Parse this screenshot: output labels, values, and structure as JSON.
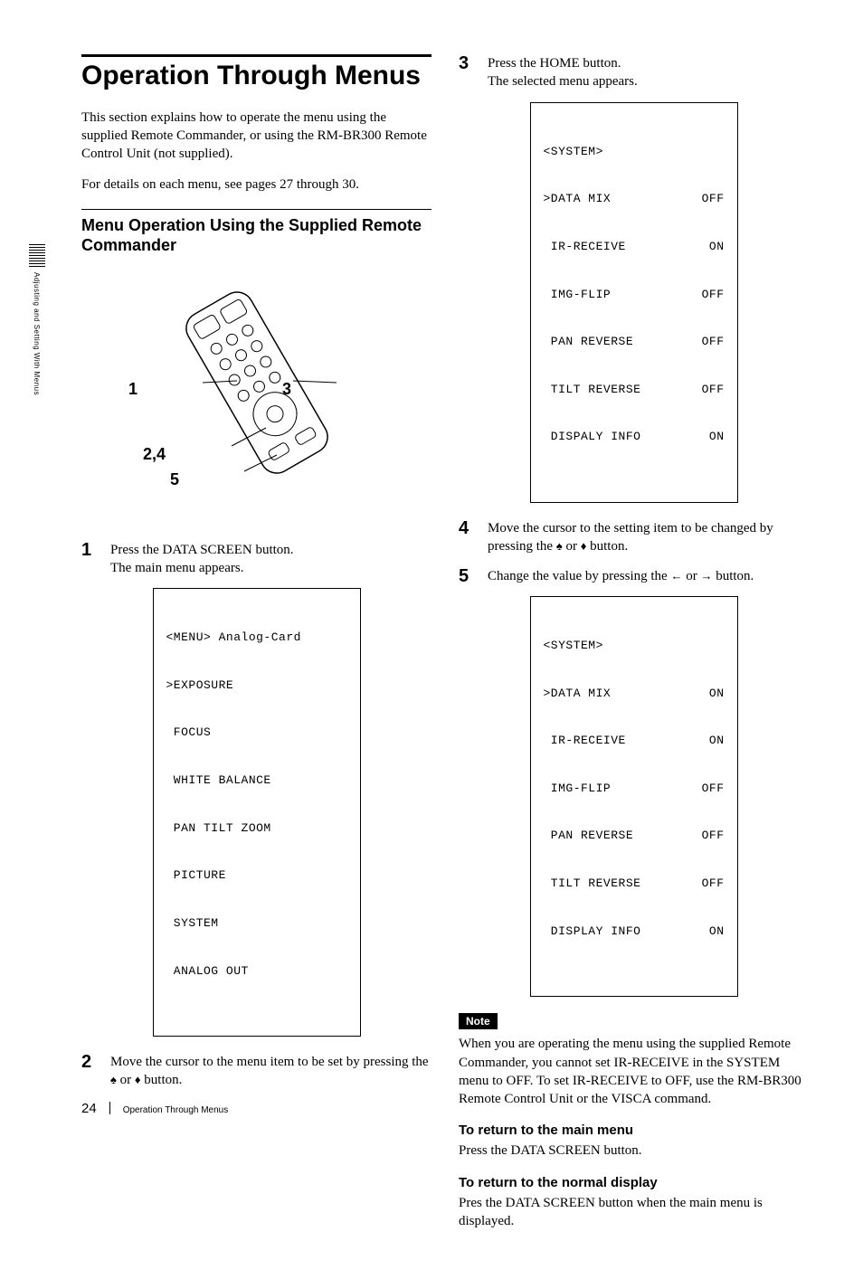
{
  "side_tab": "Adjusting and Setting With Menus",
  "title": "Operation Through Menus",
  "intro_p1": "This section explains how to operate the menu using the supplied Remote Commander, or using the RM-BR300 Remote Control Unit (not supplied).",
  "intro_p2": "For details on each menu, see pages 27 through 30.",
  "section_heading": "Menu Operation Using the Supplied Remote Commander",
  "callouts": {
    "c1": "1",
    "c24": "2,4",
    "c3": "3",
    "c5": "5"
  },
  "steps": {
    "s1": {
      "num": "1",
      "text_a": "Press the DATA SCREEN button.",
      "text_b": "The main menu appears."
    },
    "s2": {
      "num": "2",
      "text": "Move the cursor to the menu item to be set by pressing the ♠ or ♦ button."
    },
    "s3": {
      "num": "3",
      "text_a": "Press the HOME button.",
      "text_b": "The selected menu appears."
    },
    "s4": {
      "num": "4",
      "text": "Move the cursor to the setting item to be changed by pressing the ♠ or ♦ button."
    },
    "s5": {
      "num": "5",
      "text": "Change the value by pressing the ← or → button."
    }
  },
  "menu_screen": {
    "header": "<MENU> Analog-Card",
    "items": [
      ">EXPOSURE",
      " FOCUS",
      " WHITE BALANCE",
      " PAN TILT ZOOM",
      " PICTURE",
      " SYSTEM",
      " ANALOG OUT"
    ]
  },
  "system_screen_1": {
    "header": "<SYSTEM>",
    "rows": [
      {
        "label": ">DATA MIX",
        "val": "OFF"
      },
      {
        "label": " IR-RECEIVE",
        "val": "ON"
      },
      {
        "label": " IMG-FLIP",
        "val": "OFF"
      },
      {
        "label": " PAN REVERSE",
        "val": "OFF"
      },
      {
        "label": " TILT REVERSE",
        "val": "OFF"
      },
      {
        "label": " DISPALY INFO",
        "val": "ON"
      }
    ]
  },
  "system_screen_2": {
    "header": "<SYSTEM>",
    "rows": [
      {
        "label": ">DATA MIX",
        "val": "ON"
      },
      {
        "label": " IR-RECEIVE",
        "val": "ON"
      },
      {
        "label": " IMG-FLIP",
        "val": "OFF"
      },
      {
        "label": " PAN REVERSE",
        "val": "OFF"
      },
      {
        "label": " TILT REVERSE",
        "val": "OFF"
      },
      {
        "label": " DISPLAY INFO",
        "val": "ON"
      }
    ]
  },
  "note_label": "Note",
  "note_text": "When you are operating the menu using the supplied Remote Commander, you cannot set IR-RECEIVE in the SYSTEM menu to OFF.  To set IR-RECEIVE to OFF, use the RM-BR300 Remote Control Unit or the VISCA command.",
  "return_main_h": "To return to the main menu",
  "return_main_t": "Press the DATA SCREEN button.",
  "return_norm_h": "To return to the normal display",
  "return_norm_t": "Pres the DATA SCREEN button when the main menu is displayed.",
  "footer": {
    "page": "24",
    "title": "Operation Through Menus"
  }
}
